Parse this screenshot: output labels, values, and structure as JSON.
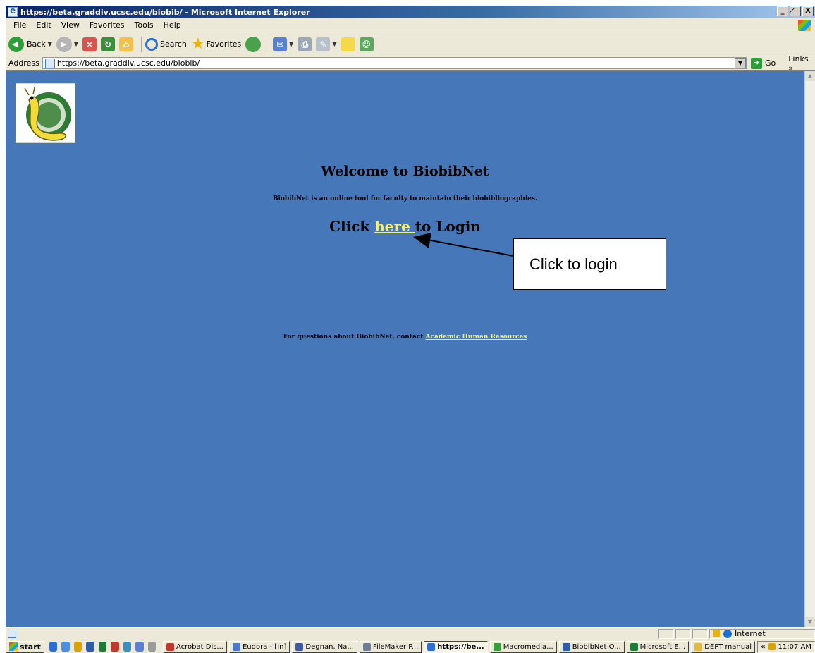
{
  "window": {
    "title": "https://beta.graddiv.ucsc.edu/biobib/ - Microsoft Internet Explorer",
    "minimize": "_",
    "maximize": "̸",
    "close": "X"
  },
  "menu": [
    "File",
    "Edit",
    "View",
    "Favorites",
    "Tools",
    "Help"
  ],
  "toolbar": {
    "back_label": "Back",
    "search_label": "Search",
    "favorites_label": "Favorites"
  },
  "address": {
    "label": "Address",
    "url": "https://beta.graddiv.ucsc.edu/biobib/",
    "go_label": "Go",
    "links_label": "Links »"
  },
  "page": {
    "welcome": "Welcome to BiobibNet",
    "description": "BiobibNet is an online tool for faculty to maintain their biobibliographies.",
    "login_prefix": "Click ",
    "login_link": "here ",
    "login_suffix": "to Login",
    "footer_prefix": "For questions about BiobibNet, contact ",
    "footer_link": "Academic Human Resources",
    "background_color": "#4677b9",
    "link_color": "#f7f26a"
  },
  "annotation": {
    "callout_text": "Click to login"
  },
  "status": {
    "zone": "Internet"
  },
  "taskbar": {
    "start": "start",
    "tasks": [
      {
        "label": "Acrobat Dis...",
        "color": "#c0392b",
        "active": false
      },
      {
        "label": "Eudora - [In]",
        "color": "#4a78c8",
        "active": false
      },
      {
        "label": "Degnan, Na...",
        "color": "#3b5aa8",
        "active": false
      },
      {
        "label": "FileMaker P...",
        "color": "#6e7f93",
        "active": false
      },
      {
        "label": "https://be...",
        "color": "#2a6fd1",
        "active": true
      },
      {
        "label": "Macromedia...",
        "color": "#3a9c3a",
        "active": false
      },
      {
        "label": "BiobibNet O...",
        "color": "#2f5ea8",
        "active": false
      },
      {
        "label": "Microsoft E...",
        "color": "#1f7a3a",
        "active": false
      },
      {
        "label": "DEPT manual",
        "color": "#e1b93b",
        "active": false
      }
    ],
    "tray_chevron": "«",
    "clock": "11:07 AM"
  }
}
